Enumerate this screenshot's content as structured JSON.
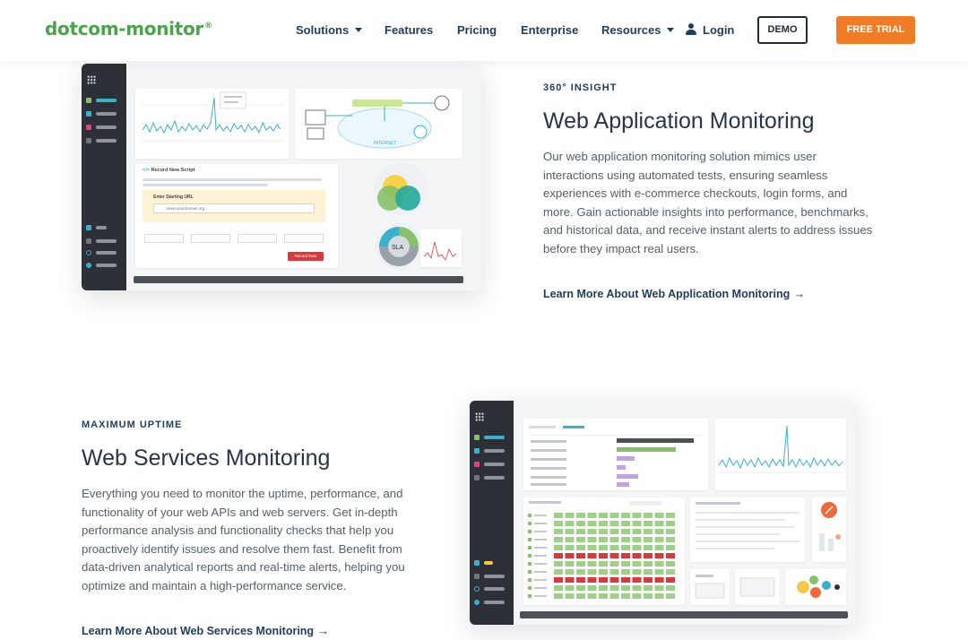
{
  "nav": {
    "logo": "dotcom-monitor",
    "logo_mark": "®",
    "items": [
      {
        "label": "Solutions",
        "has_dropdown": true
      },
      {
        "label": "Features",
        "has_dropdown": false
      },
      {
        "label": "Pricing",
        "has_dropdown": false
      },
      {
        "label": "Enterprise",
        "has_dropdown": false
      },
      {
        "label": "Resources",
        "has_dropdown": true
      }
    ],
    "login": {
      "label": "Login",
      "icon": "user-icon"
    },
    "demo_button": "DEMO",
    "trial_button": "FREE TRIAL"
  },
  "section_web_app": {
    "eyebrow": "360° INSIGHT",
    "title": "Web Application Monitoring",
    "description": "Our web application monitoring solution mimics user interactions using automated tests, ensuring seamless experiences with e-commerce checkouts, login forms, and more. Gain actionable insights into performance, benchmarks, and historical data, and receive instant alerts to address issues before they impact real users.",
    "link": "Learn More About Web Application Monitoring",
    "mockup": {
      "record_title": "Record New Script",
      "url_label": "Enter Starting URL",
      "url_value": "www.yourdomain.org",
      "network_label": "INTERNET",
      "sla_label": "SLA",
      "action_label": "Record Now"
    }
  },
  "section_web_services": {
    "eyebrow": "MAXIMUM UPTIME",
    "title": "Web Services Monitoring",
    "description": "Everything you need to monitor the uptime, performance, and functionality of your web APIs and web servers. Get in-depth performance analysis and functionality checks that help you proactively identify issues and resolve them fast. Benefit from data-driven analytical reports and real-time alerts, helping you optimize and maintain a high-performance service.",
    "link": "Learn More About Web Services Monitoring"
  },
  "colors": {
    "brand_green": "#4ba34b",
    "accent_orange": "#f07d26",
    "navy": "#1f3d5a",
    "chart_line": "#3ab0c9",
    "error_red": "#d9393e",
    "ok_green": "#86c06a"
  }
}
